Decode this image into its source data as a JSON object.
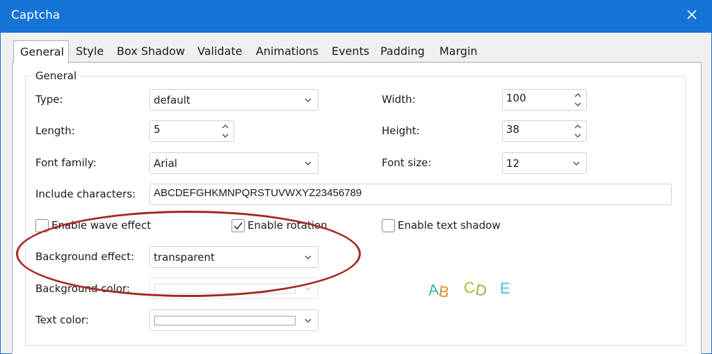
{
  "window": {
    "title": "Captcha"
  },
  "tabs": [
    "General",
    "Style",
    "Box Shadow",
    "Validate",
    "Animations",
    "Events",
    "Padding",
    "Margin"
  ],
  "group": {
    "legend": "General"
  },
  "fields": {
    "type": {
      "label": "Type:",
      "value": "default"
    },
    "width": {
      "label": "Width:",
      "value": "100"
    },
    "length": {
      "label": "Length:",
      "value": "5"
    },
    "height": {
      "label": "Height:",
      "value": "38"
    },
    "font_family": {
      "label": "Font family:",
      "value": "Arial"
    },
    "font_size": {
      "label": "Font size:",
      "value": "12"
    },
    "include_characters": {
      "label": "Include characters:",
      "value": "ABCDEFGHKMNPQRSTUVWXYZ23456789"
    },
    "background_effect": {
      "label": "Background effect:",
      "value": "transparent"
    },
    "background_color": {
      "label": "Background color:",
      "value": "#ffffff",
      "enabled": false
    },
    "text_color": {
      "label": "Text color:",
      "value": "#ffffff"
    }
  },
  "checkboxes": {
    "wave": {
      "label": "Enable wave effect",
      "checked": false
    },
    "rotation": {
      "label": "Enable rotation",
      "checked": true
    },
    "text_shadow": {
      "label": "Enable text shadow",
      "checked": false
    }
  },
  "preview": {
    "chars": [
      {
        "ch": "A",
        "color": "#2fb8b0"
      },
      {
        "ch": "B",
        "color": "#e08a2c"
      },
      {
        "ch": "C",
        "color": "#b5b52a"
      },
      {
        "ch": "D",
        "color": "#8fb82a"
      },
      {
        "ch": "E",
        "color": "#3ac8d8"
      }
    ]
  },
  "colors": {
    "titlebar": "#1573d6",
    "annotation": "#a5271f"
  },
  "icons": [
    "close-icon",
    "chevron-down-icon",
    "chevron-up-icon",
    "checkmark-icon"
  ]
}
